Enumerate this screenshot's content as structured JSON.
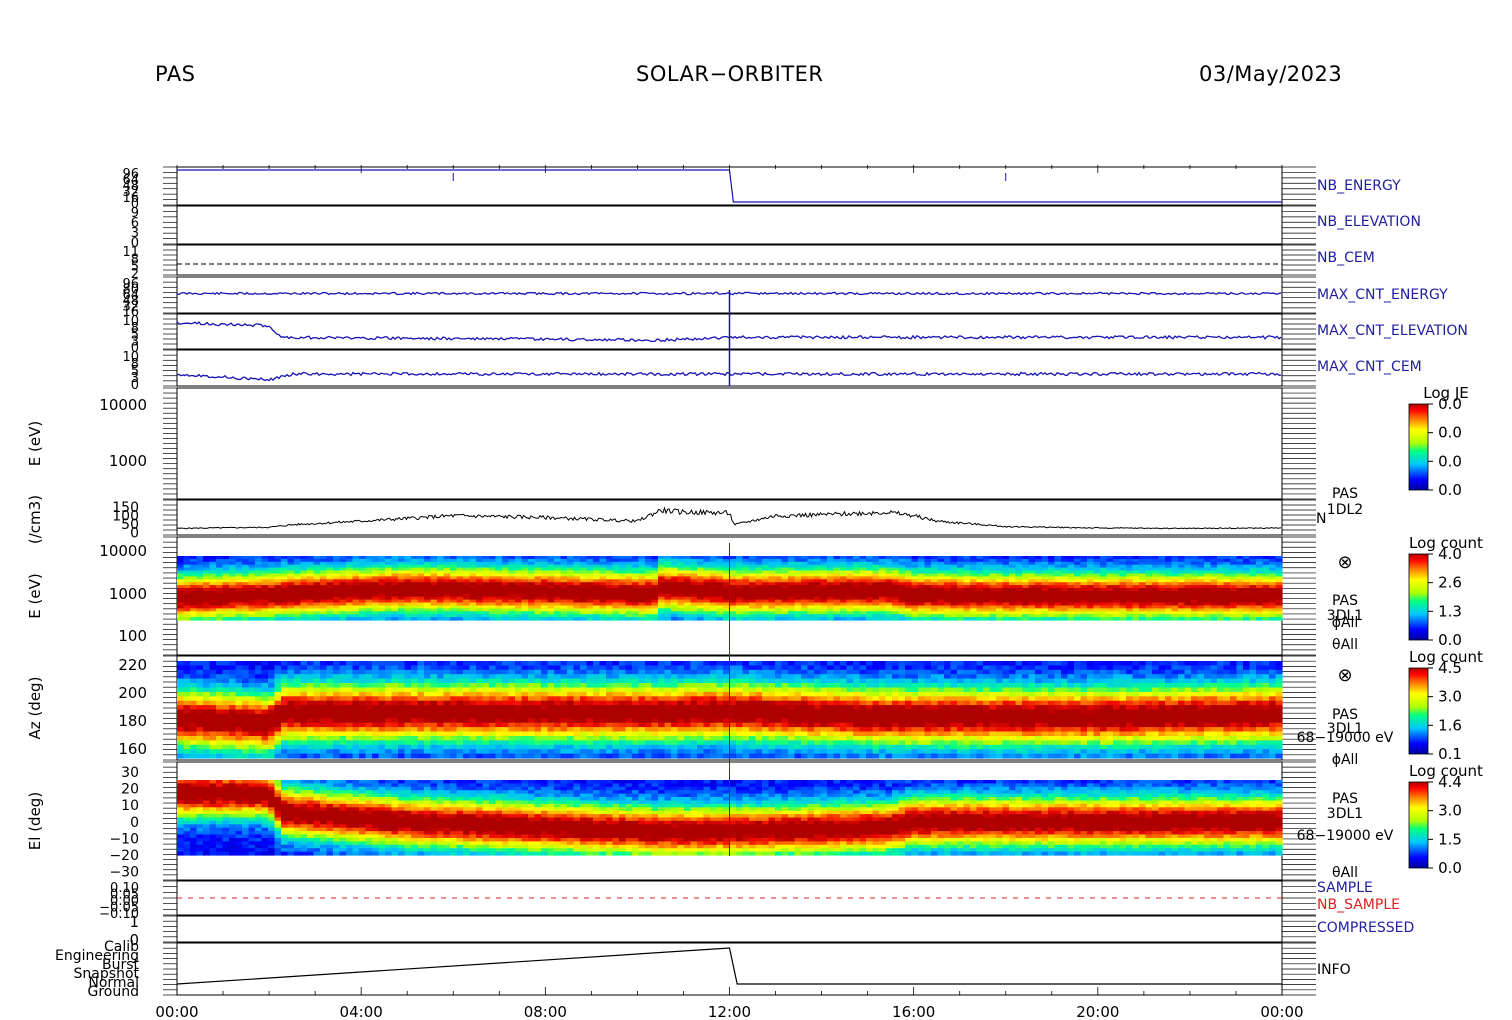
{
  "header": {
    "left": "PAS",
    "center": "SOLAR−ORBITER",
    "right": "03/May/2023"
  },
  "colors": {
    "trace_blue": "#1414b4",
    "trace_black": "#000000",
    "sample_red": "#dd2020",
    "label_blue": "#2020a0",
    "label_red": "#dd2020"
  },
  "chart_data": [
    {
      "id": "nb_energy",
      "type": "line",
      "label": "NB_ENERGY",
      "ytick_labels": [
        "96",
        "64",
        "48",
        "32",
        "16",
        "0"
      ],
      "x": [
        "00:00",
        "12:00",
        "12:05",
        "24:00"
      ],
      "values": [
        96,
        96,
        0,
        0
      ],
      "spikes_at": [
        "06:00",
        "18:00"
      ]
    },
    {
      "id": "nb_elevation",
      "type": "line",
      "label": "NB_ELEVATION",
      "ytick_labels": [
        "9",
        "6",
        "3",
        "0"
      ]
    },
    {
      "id": "nb_cem",
      "type": "line",
      "label": "NB_CEM",
      "ytick_labels": [
        "11",
        "8",
        "5",
        "2"
      ],
      "value": 4,
      "style": "dashed"
    },
    {
      "id": "max_cnt_energy",
      "type": "line",
      "label": "MAX_CNT_ENERGY",
      "ytick_labels": [
        "96",
        "80",
        "64",
        "48",
        "32",
        "16"
      ],
      "approx_value": 70
    },
    {
      "id": "max_cnt_elevation",
      "type": "line",
      "label": "MAX_CNT_ELEVATION",
      "ytick_labels": [
        "10",
        "8",
        "5",
        "3",
        "0"
      ],
      "approx_x": [
        "00:00",
        "02:00",
        "02:15",
        "10:30",
        "12:00",
        "24:00"
      ],
      "approx_values": [
        8,
        7,
        3,
        2,
        3,
        3
      ]
    },
    {
      "id": "max_cnt_cem",
      "type": "line",
      "label": "MAX_CNT_CEM",
      "ytick_labels": [
        "10",
        "8",
        "5",
        "3",
        "0"
      ],
      "approx_x": [
        "00:00",
        "02:00",
        "02:30",
        "24:00"
      ],
      "approx_values": [
        3,
        1,
        3,
        3
      ]
    },
    {
      "id": "je_spectrogram",
      "type": "heatmap",
      "ylabel": "E (eV)",
      "yscale": "log",
      "ylim": [
        100,
        20000
      ],
      "ytick_labels": [
        "10000",
        "1000"
      ],
      "colorbar": {
        "title": "Log JE",
        "ticks": [
          "0.0",
          "0.0",
          "0.0",
          "0.0"
        ]
      },
      "note": "empty panel"
    },
    {
      "id": "density",
      "type": "line",
      "ylabel": "(/cm3)",
      "ytick_labels": [
        "150",
        "100",
        "50",
        "0"
      ],
      "ylim": [
        0,
        160
      ],
      "side_labels": [
        "PAS",
        "1DL2",
        "N"
      ],
      "x_hours": [
        0,
        2,
        2.5,
        4,
        6,
        8,
        10,
        10.5,
        11,
        12,
        12.1,
        13,
        14,
        15,
        15.4,
        16,
        16.5,
        18,
        20,
        22,
        24
      ],
      "values": [
        20,
        26,
        40,
        60,
        90,
        80,
        60,
        120,
        110,
        105,
        40,
        90,
        95,
        105,
        110,
        90,
        60,
        30,
        22,
        20,
        22
      ]
    },
    {
      "id": "energy_spectrogram",
      "type": "heatmap",
      "ylabel": "E (eV)",
      "yscale": "log",
      "ytick_labels": [
        "10000",
        "1000",
        "100"
      ],
      "colorbar": {
        "title": "Log count",
        "ticks": [
          "4.0",
          "2.6",
          "1.3",
          "0.0"
        ]
      },
      "side_labels": [
        "PAS",
        "3DL1",
        "ϕAll",
        "θAll"
      ],
      "symbol": "⊗",
      "peak_energy_x_hours": [
        0,
        2,
        5,
        10.4,
        10.5,
        12,
        15.4,
        16,
        20,
        24
      ],
      "peak_energy_eV": [
        800,
        950,
        1300,
        1000,
        1400,
        1100,
        1200,
        950,
        900,
        900
      ]
    },
    {
      "id": "azimuth_spectrogram",
      "type": "heatmap",
      "ylabel": "Az (deg)",
      "ylim": [
        155,
        225
      ],
      "ytick_labels": [
        "220",
        "200",
        "180",
        "160"
      ],
      "colorbar": {
        "title": "Log count",
        "ticks": [
          "4.5",
          "3.0",
          "1.6",
          "0.1"
        ]
      },
      "side_labels": [
        "PAS",
        "3DL1",
        "68−19000 eV",
        "ϕAll"
      ],
      "symbol": "⊗",
      "peak_az_x_hours": [
        0,
        2,
        2.3,
        10.5,
        12,
        15.4,
        16,
        20,
        24
      ],
      "peak_az_deg": [
        182,
        178,
        186,
        186,
        187,
        183,
        183,
        183,
        185
      ]
    },
    {
      "id": "elevation_spectrogram",
      "type": "heatmap",
      "ylabel": "El (deg)",
      "ylim": [
        -30,
        30
      ],
      "ytick_labels": [
        "30",
        "20",
        "10",
        "0",
        "−10",
        "−20",
        "−30"
      ],
      "colorbar": {
        "title": "Log count",
        "ticks": [
          "4.4",
          "3.0",
          "1.5",
          "0.0"
        ]
      },
      "side_labels": [
        "PAS",
        "3DL1",
        "68−19000 eV",
        "θAll"
      ],
      "peak_el_x_hours": [
        0,
        2,
        2.3,
        5,
        10.4,
        10.5,
        12,
        15.4,
        16,
        20,
        24
      ],
      "peak_el_deg": [
        15,
        15,
        5,
        0,
        -5,
        -5,
        -5,
        -3,
        0,
        0,
        0
      ]
    },
    {
      "id": "sample",
      "type": "line",
      "labels": [
        "SAMPLE",
        "NB_SAMPLE"
      ],
      "ytick_labels": [
        "0.10",
        "0.05",
        "0.00",
        "−0.05",
        "−0.10"
      ],
      "value": 0,
      "style": "dashed"
    },
    {
      "id": "compressed",
      "type": "line",
      "label": "COMPRESSED",
      "ytick_labels": [
        "1",
        "0"
      ]
    },
    {
      "id": "info",
      "type": "line",
      "label": "INFO",
      "ytick_labels": [
        "Calib",
        "Engineering",
        "Burst",
        "Snapshot",
        "Normal",
        "Ground"
      ],
      "x": [
        "00:00",
        "12:00",
        "12:10",
        "24:00"
      ],
      "values": [
        "Normal",
        "Calib",
        "Normal",
        "Normal"
      ]
    }
  ],
  "x_axis": {
    "tick_labels": [
      "00:00",
      "04:00",
      "08:00",
      "12:00",
      "16:00",
      "20:00",
      "00:00"
    ],
    "range_hours": [
      0,
      24
    ]
  }
}
